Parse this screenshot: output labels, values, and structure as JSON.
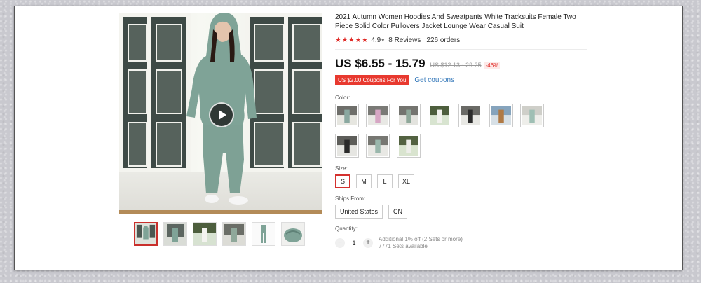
{
  "product": {
    "title": "2021 Autumn Women Hoodies And Sweatpants White Tracksuits Female Two Piece Solid Color Pullovers Jacket Lounge Wear Casual Suit",
    "stars": "★★★★★",
    "rating": "4.9",
    "reviews": "8 Reviews",
    "orders": "226 orders",
    "price": "US $6.55 - 15.79",
    "old_price": "US $12.13 - 29.25",
    "discount": "-46%",
    "coupon_badge": "US $2.00 Coupons For You",
    "get_coupons": "Get coupons"
  },
  "gallery": {
    "play_icon": "play-icon",
    "thumbnail_count": 6
  },
  "color": {
    "label": "Color:",
    "swatch_count": 10,
    "swatch_tones": [
      "#8aa8a0",
      "#d6a6c4",
      "#8fa89a",
      "#f2f2ee",
      "#2c2c2c",
      "#b07a45",
      "#9fbfb4",
      "#2a2a2a",
      "#9ab7ac",
      "#eeeeea"
    ]
  },
  "size": {
    "label": "Size:",
    "options": [
      "S",
      "M",
      "L",
      "XL"
    ],
    "selected": "S"
  },
  "ships_from": {
    "label": "Ships From:",
    "options": [
      "United States",
      "CN"
    ]
  },
  "quantity": {
    "label": "Quantity:",
    "minus": "−",
    "value": "1",
    "plus": "+",
    "note_line1": "Additional 1% off (2 Sets or more)",
    "note_line2": "7771 Sets available"
  },
  "colors": {
    "accent_red": "#e02b27",
    "link_blue": "#3679ba",
    "garment_sage": "#7fa397"
  }
}
